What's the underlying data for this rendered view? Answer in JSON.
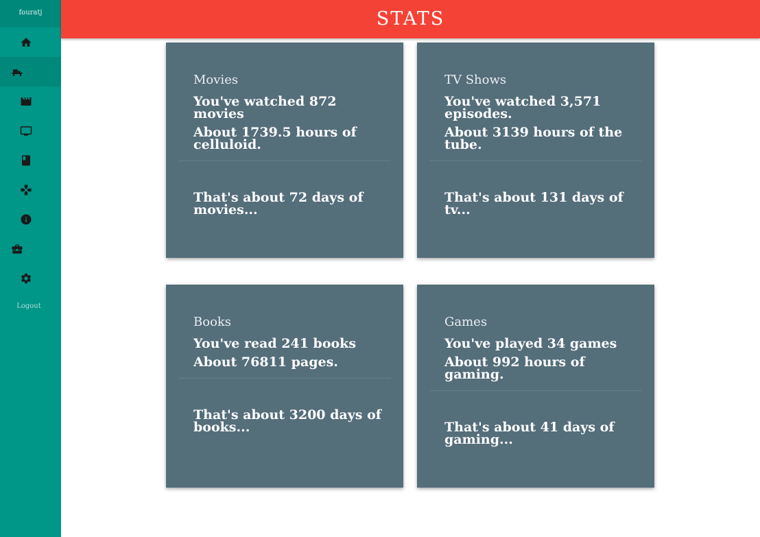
{
  "app": {
    "title": "STATS",
    "username": "fouratj",
    "logout_label": "Logout"
  },
  "sidebar": {
    "items": [
      {
        "name": "home",
        "icon": "home-icon"
      },
      {
        "name": "couch",
        "icon": "couch-icon"
      },
      {
        "name": "movies",
        "icon": "movie-icon"
      },
      {
        "name": "tv",
        "icon": "tv-icon"
      },
      {
        "name": "books",
        "icon": "book-icon"
      },
      {
        "name": "games",
        "icon": "gamepad-icon"
      },
      {
        "name": "info",
        "icon": "info-icon"
      },
      {
        "name": "work",
        "icon": "briefcase-icon"
      },
      {
        "name": "settings",
        "icon": "gear-icon"
      }
    ]
  },
  "cards": {
    "movies": {
      "title": "Movies",
      "line1": "You've watched 872 movies",
      "line2": "About 1739.5 hours of celluloid.",
      "footer": "That's about 72 days of movies..."
    },
    "tv": {
      "title": "TV Shows",
      "line1": "You've watched 3,571 episodes.",
      "line2": "About 3139 hours of the tube.",
      "footer": "That's about 131 days of tv..."
    },
    "books": {
      "title": "Books",
      "line1": "You've read 241 books",
      "line2": "About 76811 pages.",
      "footer": "That's about 3200 days of books..."
    },
    "games": {
      "title": "Games",
      "line1": "You've played 34 games",
      "line2": "About 992 hours of gaming.",
      "footer": "That's about 41 days of gaming..."
    }
  },
  "colors": {
    "sidebar": "#009688",
    "topbar": "#f44336",
    "card": "#546e7a"
  }
}
